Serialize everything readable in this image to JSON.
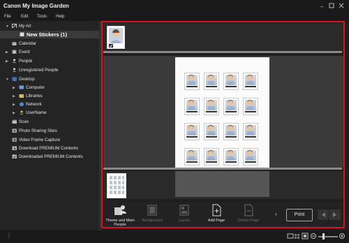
{
  "app": {
    "title": "Canon My Image Garden"
  },
  "menu": {
    "file": "File",
    "edit": "Edit",
    "tools": "Tools",
    "help": "Help"
  },
  "sidebar": {
    "my_art": "My Art",
    "new_stickers": "New Stickers (1)",
    "calendar": "Calendar",
    "event": "Event",
    "people": "People",
    "unregistered_people": "Unregistered People",
    "desktop": "Desktop",
    "computer": "Computer",
    "libraries": "Libraries",
    "network": "Network",
    "username": "UserName",
    "scan": "Scan",
    "photo_sharing_sites": "Photo Sharing Sites",
    "video_frame_capture": "Video Frame Capture",
    "download_premium": "Download PREMIUM Contents",
    "downloaded_premium": "Downloaded PREMIUM Contents"
  },
  "toolbar": {
    "theme": "Theme and Main People",
    "background": "Background",
    "layout": "Layout",
    "add_page": "Add Page",
    "delete_page": "Delete Page",
    "print": "Print"
  },
  "colors": {
    "highlight": "#e0101a",
    "bg": "#1f1f1f"
  }
}
